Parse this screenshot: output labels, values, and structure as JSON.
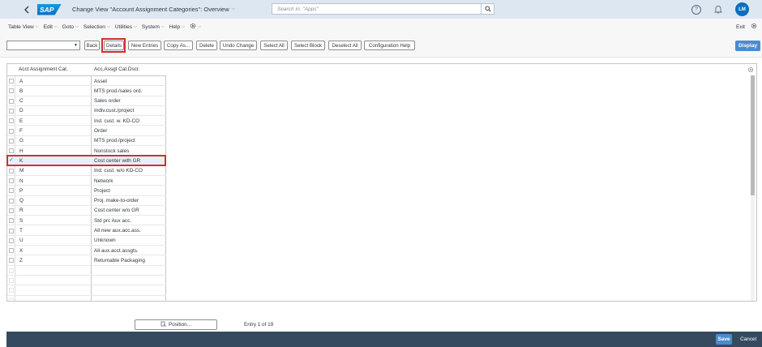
{
  "shell": {
    "logo": "SAP",
    "title": "Change View \"Account Assignment Categories\": Overview",
    "search_placeholder": "Search In: \"Apps\"",
    "user_initials": "LM"
  },
  "menubar": {
    "items": [
      "Table View",
      "Edit",
      "Goto",
      "Selection",
      "Utilities",
      "System",
      "Help"
    ],
    "exit_label": "Exit"
  },
  "toolbar": {
    "buttons": [
      "Back",
      "Details",
      "New Entries",
      "Copy As...",
      "Delete",
      "Undo Change",
      "Select All",
      "Select Block",
      "Deselect All",
      "Configuration Help"
    ],
    "display_label": "Display"
  },
  "table": {
    "columns": [
      "Acct Assignment Cat.",
      "Acc.Assgt Cat.Dscr."
    ],
    "rows": [
      {
        "code": "A",
        "desc": "Asset"
      },
      {
        "code": "B",
        "desc": "MTS prod./sales ord."
      },
      {
        "code": "C",
        "desc": "Sales order"
      },
      {
        "code": "D",
        "desc": "Indiv.cust./project"
      },
      {
        "code": "E",
        "desc": "Ind. cust. w. KD-CO"
      },
      {
        "code": "F",
        "desc": "Order"
      },
      {
        "code": "G",
        "desc": "MTS prod./project"
      },
      {
        "code": "H",
        "desc": "Nonstock sales"
      },
      {
        "code": "K",
        "desc": "Cost center with GR"
      },
      {
        "code": "M",
        "desc": "Ind. cust. w/o KD-CO"
      },
      {
        "code": "N",
        "desc": "Network"
      },
      {
        "code": "P",
        "desc": "Project"
      },
      {
        "code": "Q",
        "desc": "Proj. make-to-order"
      },
      {
        "code": "R",
        "desc": "Cost center w/o GR"
      },
      {
        "code": "S",
        "desc": "Std prc Aux acc."
      },
      {
        "code": "T",
        "desc": "All new aux.acc.ass."
      },
      {
        "code": "U",
        "desc": "Unknown"
      },
      {
        "code": "X",
        "desc": "All aux.acct.assgts."
      },
      {
        "code": "Z",
        "desc": "Returnable Packaging"
      }
    ],
    "selected_index": 8,
    "selected_mark": "✓"
  },
  "footer": {
    "position_label": "Position...",
    "entry_info": "Entry 1 of 19",
    "save_label": "Save",
    "cancel_label": "Cancel"
  },
  "colors": {
    "shell_bg": "#dde7f2",
    "footer_bg": "#354a5f",
    "emphasized_button": "#4b8bd0",
    "highlight_border": "#d0302f",
    "selected_row": "#e5f0fa"
  }
}
